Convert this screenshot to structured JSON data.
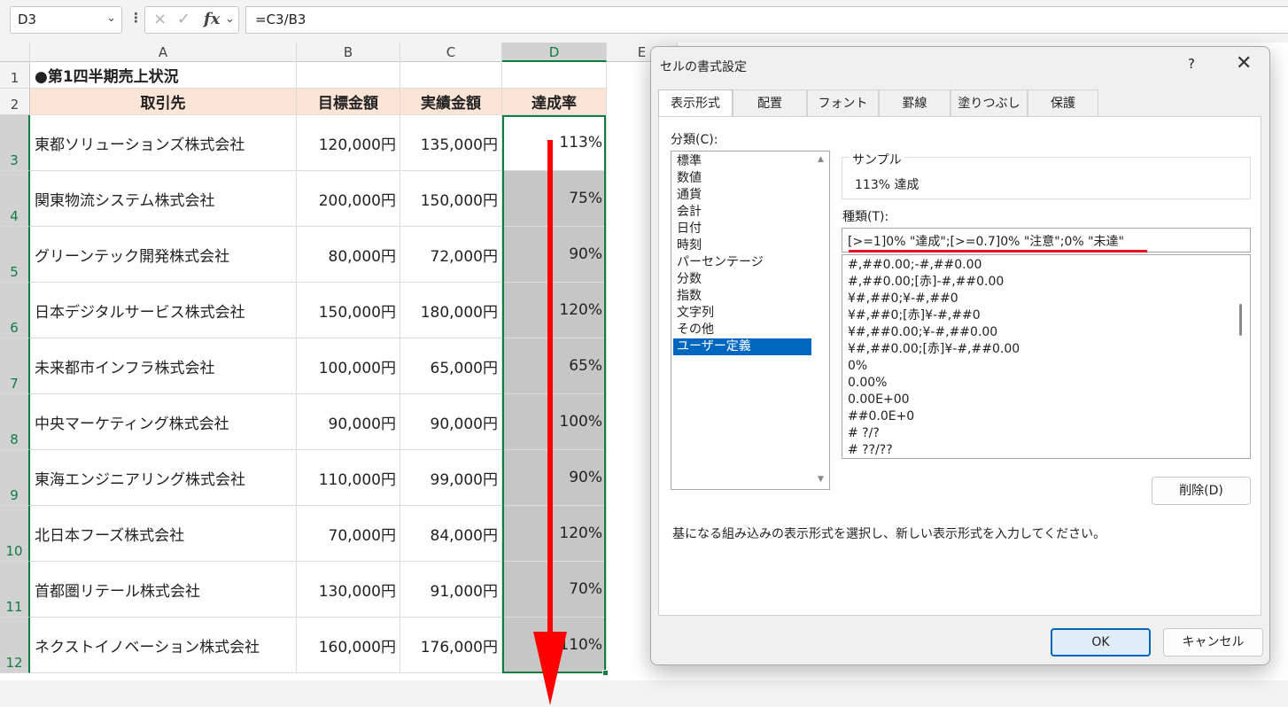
{
  "formula_bar": {
    "name_box": "D3",
    "cancel_icon": "×",
    "enter_icon": "✓",
    "fx_label": "fx",
    "formula": "=C3/B3"
  },
  "sheet": {
    "columns": [
      "A",
      "B",
      "C",
      "D",
      "E"
    ],
    "rows": [
      "1",
      "2",
      "3",
      "4",
      "5",
      "6",
      "7",
      "8",
      "9",
      "10",
      "11",
      "12"
    ],
    "title": "●第1四半期売上状況",
    "headers": [
      "取引先",
      "目標金額",
      "実績金額",
      "達成率"
    ],
    "data": [
      {
        "name": "東都ソリューションズ株式会社",
        "target": "120,000円",
        "actual": "135,000円",
        "rate": "113%"
      },
      {
        "name": "関東物流システム株式会社",
        "target": "200,000円",
        "actual": "150,000円",
        "rate": "75%"
      },
      {
        "name": "グリーンテック開発株式会社",
        "target": "80,000円",
        "actual": "72,000円",
        "rate": "90%"
      },
      {
        "name": "日本デジタルサービス株式会社",
        "target": "150,000円",
        "actual": "180,000円",
        "rate": "120%"
      },
      {
        "name": "未来都市インフラ株式会社",
        "target": "100,000円",
        "actual": "65,000円",
        "rate": "65%"
      },
      {
        "name": "中央マーケティング株式会社",
        "target": "90,000円",
        "actual": "90,000円",
        "rate": "100%"
      },
      {
        "name": "東海エンジニアリング株式会社",
        "target": "110,000円",
        "actual": "99,000円",
        "rate": "90%"
      },
      {
        "name": "北日本フーズ株式会社",
        "target": "70,000円",
        "actual": "84,000円",
        "rate": "120%"
      },
      {
        "name": "首都圏リテール株式会社",
        "target": "130,000円",
        "actual": "91,000円",
        "rate": "70%"
      },
      {
        "name": "ネクストイノベーション株式会社",
        "target": "160,000円",
        "actual": "176,000円",
        "rate": "110%"
      }
    ],
    "arrow_color": "#ff0000"
  },
  "dialog": {
    "title": "セルの書式設定",
    "help": "?",
    "close": "✕",
    "tabs": [
      "表示形式",
      "配置",
      "フォント",
      "罫線",
      "塗りつぶし",
      "保護"
    ],
    "category_label": "分類(C):",
    "categories": [
      "標準",
      "数値",
      "通貨",
      "会計",
      "日付",
      "時刻",
      "パーセンテージ",
      "分数",
      "指数",
      "文字列",
      "その他",
      "ユーザー定義"
    ],
    "selected_category": "ユーザー定義",
    "sample_label": "サンプル",
    "sample_value": "113% 達成",
    "type_label": "種類(T):",
    "type_value": "[>=1]0% \"達成\";[>=0.7]0% \"注意\";0% \"未達\"",
    "formats": [
      "#,##0.00;-#,##0.00",
      "#,##0.00;[赤]-#,##0.00",
      "¥#,##0;¥-#,##0",
      "¥#,##0;[赤]¥-#,##0",
      "¥#,##0.00;¥-#,##0.00",
      "¥#,##0.00;[赤]¥-#,##0.00",
      "0%",
      "0.00%",
      "0.00E+00",
      "##0.0E+0",
      "# ?/?",
      "# ??/??"
    ],
    "delete_button": "削除(D)",
    "description": "基になる組み込みの表示形式を選択し、新しい表示形式を入力してください。",
    "ok_button": "OK",
    "cancel_button": "キャンセル",
    "underline_color": "#e81123",
    "accent_color": "#0067c0"
  }
}
